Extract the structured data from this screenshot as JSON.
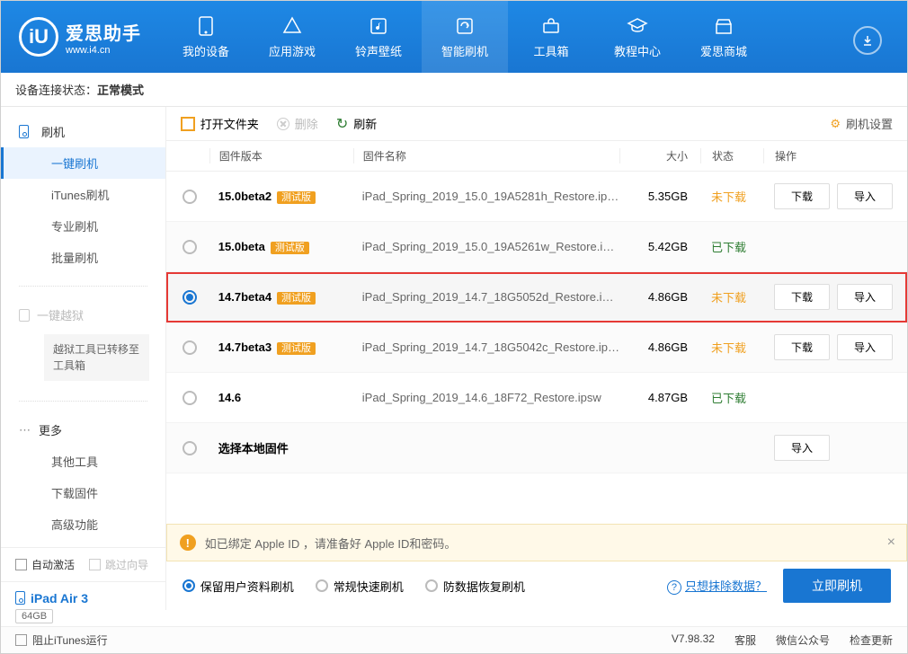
{
  "window_controls": [
    "⎘",
    "≡",
    "—",
    "◻",
    "✕"
  ],
  "brand": {
    "name": "爱思助手",
    "url": "www.i4.cn"
  },
  "nav": [
    {
      "label": "我的设备"
    },
    {
      "label": "应用游戏"
    },
    {
      "label": "铃声壁纸"
    },
    {
      "label": "智能刷机"
    },
    {
      "label": "工具箱"
    },
    {
      "label": "教程中心"
    },
    {
      "label": "爱思商城"
    }
  ],
  "status_bar": {
    "prefix": "设备连接状态：",
    "value": "正常模式"
  },
  "sidebar": {
    "flash": {
      "title": "刷机",
      "items": [
        "一键刷机",
        "iTunes刷机",
        "专业刷机",
        "批量刷机"
      ],
      "active": 0
    },
    "jailbreak": {
      "title": "一键越狱",
      "notice": "越狱工具已转移至工具箱"
    },
    "more": {
      "title": "更多",
      "items": [
        "其他工具",
        "下载固件",
        "高级功能"
      ]
    },
    "checks": {
      "auto_activate": "自动激活",
      "skip_guide": "跳过向导"
    },
    "device": {
      "name": "iPad Air 3",
      "storage": "64GB",
      "model": "iPad"
    }
  },
  "toolbar": {
    "open": "打开文件夹",
    "delete": "删除",
    "refresh": "刷新",
    "settings": "刷机设置"
  },
  "columns": {
    "version": "固件版本",
    "name": "固件名称",
    "size": "大小",
    "status": "状态",
    "actions": "操作"
  },
  "beta_tag": "测试版",
  "btn_download": "下载",
  "btn_import": "导入",
  "rows": [
    {
      "version": "15.0beta2",
      "beta": true,
      "name": "iPad_Spring_2019_15.0_19A5281h_Restore.ip…",
      "size": "5.35GB",
      "status": "未下载",
      "status_class": "status-not",
      "actions": [
        "下载",
        "导入"
      ]
    },
    {
      "version": "15.0beta",
      "beta": true,
      "name": "iPad_Spring_2019_15.0_19A5261w_Restore.i…",
      "size": "5.42GB",
      "status": "已下载",
      "status_class": "status-done",
      "actions": []
    },
    {
      "version": "14.7beta4",
      "beta": true,
      "name": "iPad_Spring_2019_14.7_18G5052d_Restore.i…",
      "size": "4.86GB",
      "status": "未下载",
      "status_class": "status-not",
      "actions": [
        "下载",
        "导入"
      ],
      "selected": true,
      "highlight": true
    },
    {
      "version": "14.7beta3",
      "beta": true,
      "name": "iPad_Spring_2019_14.7_18G5042c_Restore.ip…",
      "size": "4.86GB",
      "status": "未下载",
      "status_class": "status-not",
      "actions": [
        "下载",
        "导入"
      ]
    },
    {
      "version": "14.6",
      "beta": false,
      "name": "iPad_Spring_2019_14.6_18F72_Restore.ipsw",
      "size": "4.87GB",
      "status": "已下载",
      "status_class": "status-done",
      "actions": []
    },
    {
      "version": "选择本地固件",
      "beta": false,
      "name": "",
      "size": "",
      "status": "",
      "status_class": "",
      "actions": [
        "导入"
      ],
      "local": true
    }
  ],
  "alert": "如已绑定 Apple ID ，请准备好 Apple ID和密码。",
  "flash_options": [
    {
      "label": "保留用户资料刷机",
      "selected": true
    },
    {
      "label": "常规快速刷机",
      "selected": false
    },
    {
      "label": "防数据恢复刷机",
      "selected": false
    }
  ],
  "erase_link": "只想抹除数据？",
  "flash_button": "立即刷机",
  "footer": {
    "block_itunes": "阻止iTunes运行",
    "version": "V7.98.32",
    "links": [
      "客服",
      "微信公众号",
      "检查更新"
    ]
  }
}
